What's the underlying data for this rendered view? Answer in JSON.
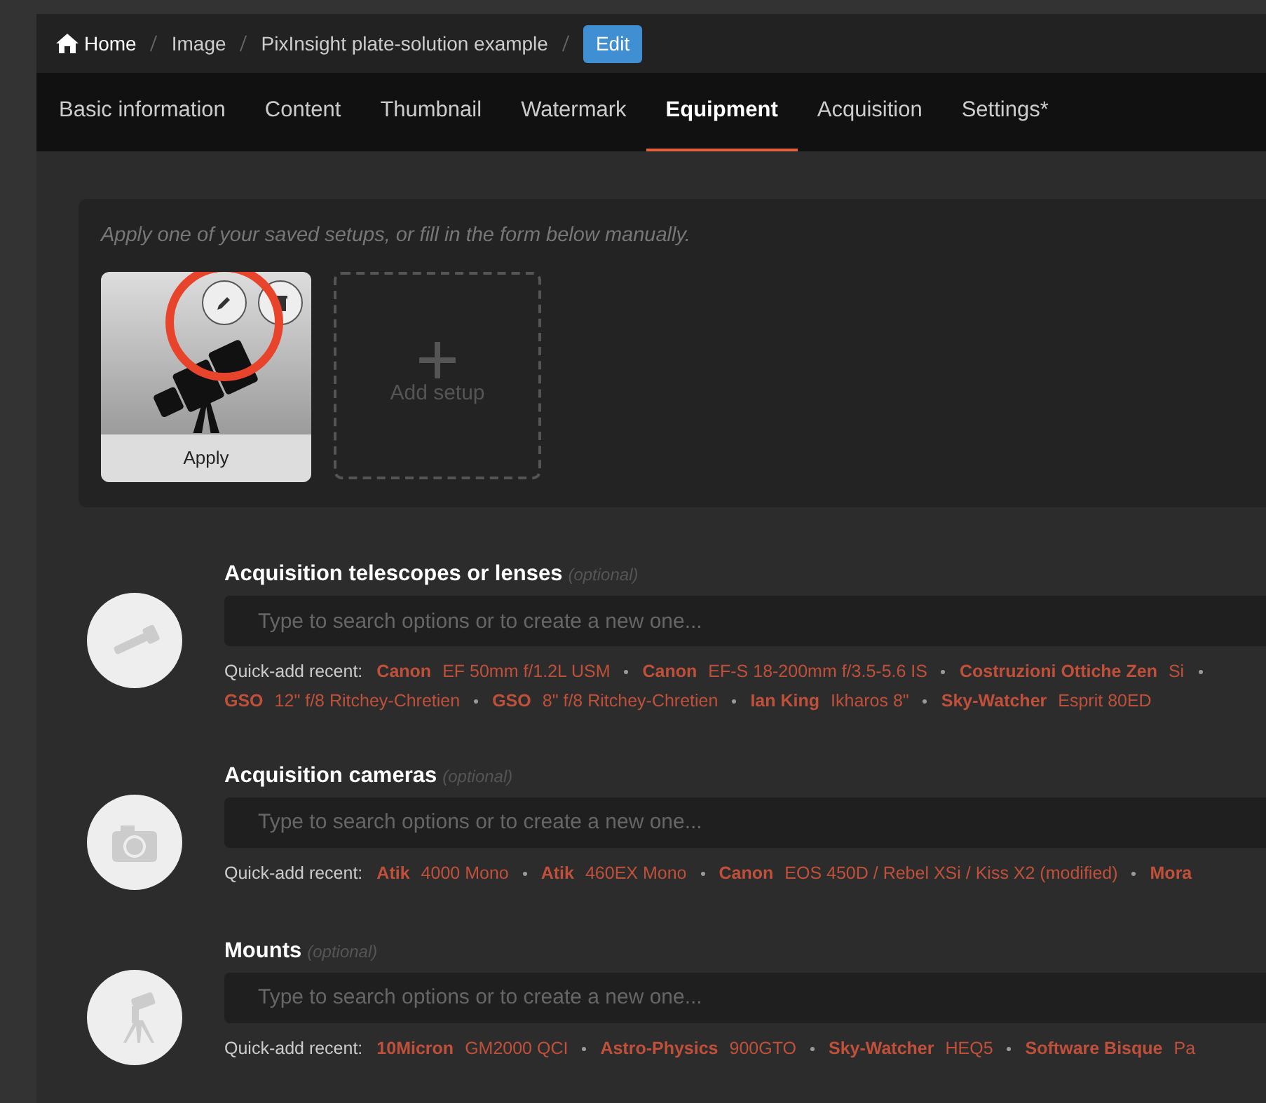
{
  "breadcrumb": {
    "items": [
      {
        "label": "Home",
        "kind": "home"
      },
      {
        "label": "Image",
        "kind": "link"
      },
      {
        "label": "PixInsight plate-solution example",
        "kind": "link"
      }
    ],
    "action": "Edit"
  },
  "tabs": [
    {
      "label": "Basic information",
      "selected": false
    },
    {
      "label": "Content",
      "selected": false
    },
    {
      "label": "Thumbnail",
      "selected": false
    },
    {
      "label": "Watermark",
      "selected": false
    },
    {
      "label": "Equipment",
      "selected": true
    },
    {
      "label": "Acquisition",
      "selected": false
    },
    {
      "label": "Settings*",
      "selected": false
    }
  ],
  "setups": {
    "hint": "Apply one of your saved setups, or fill in the form below manually.",
    "saved": [
      {
        "apply": "Apply",
        "highlighted": true
      }
    ],
    "add": "Add setup"
  },
  "sections": [
    {
      "kind": "telescope",
      "title": "Acquisition telescopes or lenses",
      "note": "(optional)",
      "placeholder": "Type to search options or to create a new one...",
      "quick_label": "Quick-add recent:",
      "recent": [
        {
          "brand": "Canon",
          "model": "EF 50mm f/1.2L USM"
        },
        {
          "brand": "Canon",
          "model": "EF-S 18-200mm f/3.5-5.6 IS"
        },
        {
          "brand": "Costruzioni Ottiche Zen",
          "model": "Si"
        },
        {
          "brand": "GSO",
          "model": "12\" f/8 Ritchey-Chretien"
        },
        {
          "brand": "GSO",
          "model": "8\" f/8 Ritchey-Chretien"
        },
        {
          "brand": "Ian King",
          "model": "Ikharos 8\""
        },
        {
          "brand": "Sky-Watcher",
          "model": "Esprit 80ED"
        }
      ]
    },
    {
      "kind": "camera",
      "title": "Acquisition cameras",
      "note": "(optional)",
      "placeholder": "Type to search options or to create a new one...",
      "quick_label": "Quick-add recent:",
      "recent": [
        {
          "brand": "Atik",
          "model": "4000 Mono"
        },
        {
          "brand": "Atik",
          "model": "460EX Mono"
        },
        {
          "brand": "Canon",
          "model": "EOS 450D / Rebel XSi / Kiss X2 (modified)"
        },
        {
          "brand": "Mora"
        }
      ]
    },
    {
      "kind": "mount",
      "title": "Mounts",
      "note": "(optional)",
      "placeholder": "Type to search options or to create a new one...",
      "quick_label": "Quick-add recent:",
      "recent": [
        {
          "brand": "10Micron",
          "model": "GM2000 QCI"
        },
        {
          "brand": "Astro-Physics",
          "model": "900GTO"
        },
        {
          "brand": "Sky-Watcher",
          "model": "HEQ5"
        },
        {
          "brand": "Software Bisque",
          "model": "Pa"
        }
      ]
    }
  ]
}
